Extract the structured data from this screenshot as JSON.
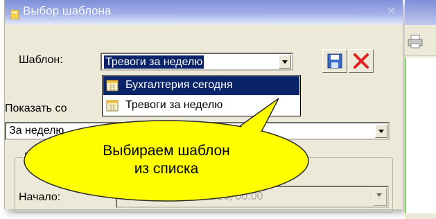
{
  "dialog": {
    "title": "Выбор шаблона",
    "template_label": "Шаблон:",
    "template_value": "Тревоги за неделю",
    "dropdown_items": [
      {
        "label": "Бухгалтерия сегодня",
        "selected": true
      },
      {
        "label": "Тревоги за неделю",
        "selected": false
      }
    ],
    "show_label": "Показать со",
    "period_value": "За неделю",
    "group_label": "И",
    "start_label": "Начало:",
    "start_value": "2016, 00:00"
  },
  "callout": {
    "line1": "Выбираем шаблон",
    "line2": "из списка"
  },
  "colors": {
    "selection": "#0a246a",
    "callout_fill": "#ffff00",
    "delete_red": "#e02020",
    "window_bg": "#ece9d8"
  },
  "icons": [
    "window-icon",
    "close-icon",
    "save-icon",
    "delete-icon",
    "calendar-icon",
    "printer-icon"
  ]
}
